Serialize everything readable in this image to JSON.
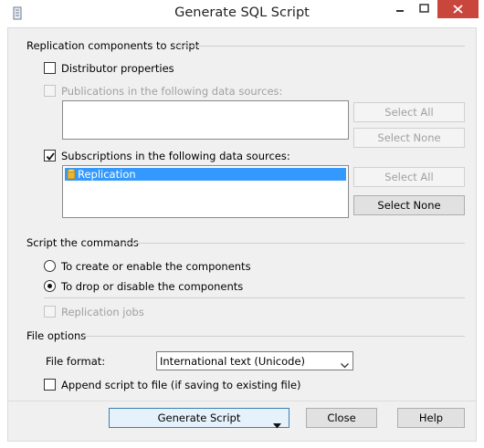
{
  "window": {
    "title": "Generate SQL Script"
  },
  "replication": {
    "section_label": "Replication components to script",
    "distributor": {
      "label": "Distributor properties",
      "checked": false,
      "enabled": true
    },
    "publications": {
      "label": "Publications in the following data sources:",
      "checked": false,
      "enabled": false,
      "items": [],
      "select_all": "Select All",
      "select_none": "Select None"
    },
    "subscriptions": {
      "label": "Subscriptions in the following data sources:",
      "checked": true,
      "enabled": true,
      "items": [
        {
          "label": "Replication",
          "selected": true,
          "icon": "database-icon"
        }
      ],
      "select_all": "Select All",
      "select_none": "Select None"
    }
  },
  "commands": {
    "section_label": "Script the commands",
    "create_option": {
      "label": "To create or enable the components",
      "selected": false
    },
    "drop_option": {
      "label": "To drop or disable the components",
      "selected": true
    },
    "replication_jobs": {
      "label": "Replication jobs",
      "checked": false,
      "enabled": false
    }
  },
  "file_options": {
    "section_label": "File options",
    "format_label": "File format:",
    "format_value": "International text (Unicode)",
    "append": {
      "label": "Append script to file (if saving to existing file)",
      "checked": false
    }
  },
  "footer": {
    "generate_label": "Generate Script",
    "close_label": "Close",
    "help_label": "Help"
  },
  "colors": {
    "selection": "#3399ff",
    "close_button": "#c9463d",
    "dialog_background": "#f0f0f0"
  }
}
